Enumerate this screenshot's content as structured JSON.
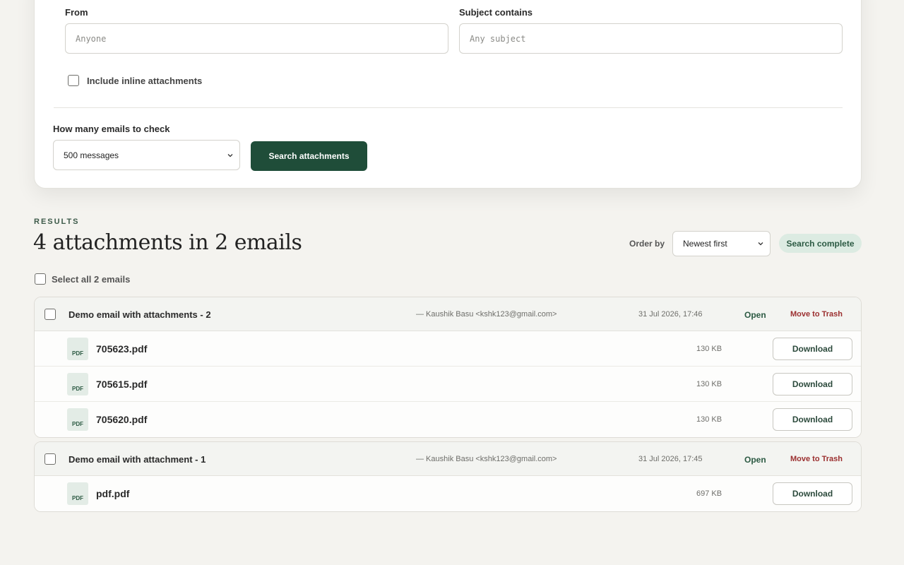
{
  "filters": {
    "from_label": "From",
    "from_placeholder": "Anyone",
    "subject_label": "Subject contains",
    "subject_placeholder": "Any subject",
    "inline_label": "Include inline attachments",
    "count_label": "How many emails to check",
    "count_value": "500 messages",
    "search_button": "Search attachments"
  },
  "results": {
    "kicker": "RESULTS",
    "title": "4 attachments in 2 emails",
    "order_label": "Order by",
    "order_value": "Newest first",
    "status": "Search complete",
    "select_all": "Select all 2 emails"
  },
  "emails": [
    {
      "subject": "Demo email with attachments - 2",
      "from": "— Kaushik Basu <kshk123@gmail.com>",
      "date": "31 Jul 2026, 17:46",
      "open": "Open",
      "trash": "Move to Trash",
      "attachments": [
        {
          "type": "PDF",
          "name": "705623.pdf",
          "size": "130 KB",
          "action": "Download"
        },
        {
          "type": "PDF",
          "name": "705615.pdf",
          "size": "130 KB",
          "action": "Download"
        },
        {
          "type": "PDF",
          "name": "705620.pdf",
          "size": "130 KB",
          "action": "Download"
        }
      ]
    },
    {
      "subject": "Demo email with attachment - 1",
      "from": "— Kaushik Basu <kshk123@gmail.com>",
      "date": "31 Jul 2026, 17:45",
      "open": "Open",
      "trash": "Move to Trash",
      "attachments": [
        {
          "type": "PDF",
          "name": "pdf.pdf",
          "size": "697 KB",
          "action": "Download"
        }
      ]
    }
  ],
  "colors": {
    "primary": "#1f4d39",
    "danger": "#9b2f2f",
    "success_bg": "#dcebe2"
  }
}
